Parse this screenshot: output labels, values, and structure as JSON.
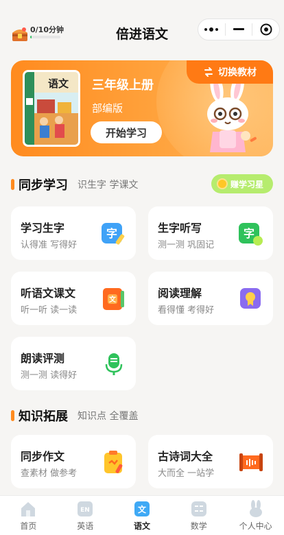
{
  "header": {
    "title": "倍进语文",
    "progress_text": "0/10分钟",
    "progress_fraction": 0.05,
    "menu_icon": "more-dots-icon",
    "minimize_icon": "minimize-icon",
    "close_icon": "target-close-icon"
  },
  "banner": {
    "grade": "三年级上册",
    "edition": "部编版",
    "start_label": "开始学习",
    "switch_label": "切换教材",
    "book_cover_title": "语文"
  },
  "sections": {
    "sync": {
      "title": "同步学习",
      "subtitle": "识生字 学课文",
      "earn_label": "赚学习星",
      "cards": [
        {
          "title": "学习生字",
          "sub": "认得准 写得好",
          "icon": "character-pen-icon",
          "icon_text": "字"
        },
        {
          "title": "生字听写",
          "sub": "测一测 巩固记",
          "icon": "character-dictation-icon",
          "icon_text": "字"
        },
        {
          "title": "听语文课文",
          "sub": "听一听 读一读",
          "icon": "textbook-audio-icon",
          "icon_text": "文"
        },
        {
          "title": "阅读理解",
          "sub": "看得懂 考得好",
          "icon": "reading-badge-icon"
        },
        {
          "title": "朗读评测",
          "sub": "测一测 读得好",
          "icon": "microphone-icon"
        }
      ]
    },
    "extend": {
      "title": "知识拓展",
      "subtitle": "知识点 全覆盖",
      "cards": [
        {
          "title": "同步作文",
          "sub": "查素材 做参考",
          "icon": "composition-clipboard-icon"
        },
        {
          "title": "古诗词大全",
          "sub": "大而全 一站学",
          "icon": "poetry-scroll-icon"
        }
      ]
    }
  },
  "tabbar": {
    "items": [
      {
        "label": "首页",
        "icon": "home-icon",
        "active": false
      },
      {
        "label": "英语",
        "icon": "english-icon",
        "icon_text": "EN",
        "active": false
      },
      {
        "label": "语文",
        "icon": "chinese-icon",
        "icon_text": "文",
        "active": true
      },
      {
        "label": "数学",
        "icon": "math-icon",
        "active": false
      },
      {
        "label": "个人中心",
        "icon": "profile-bunny-icon",
        "active": false
      }
    ]
  },
  "colors": {
    "accent": "#ff8b1f",
    "banner_start": "#ff8b1f",
    "banner_end": "#ffb45a",
    "progress": "#3cc46b",
    "earn_pill": "#b6ec6e",
    "active_tab": "#3fa9f5"
  }
}
